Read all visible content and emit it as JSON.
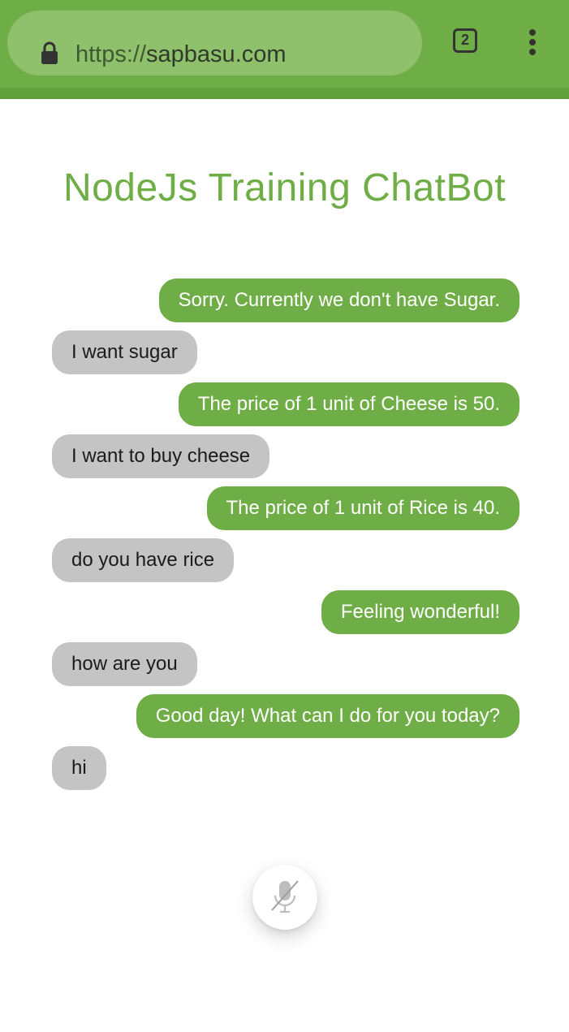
{
  "browser": {
    "url_scheme": "https://",
    "url_host": "sapbasu.com",
    "tab_count": "2",
    "lock_icon": "lock-icon",
    "menu_icon": "overflow-menu-icon",
    "toolbar_color": "#6fad46"
  },
  "page": {
    "title": "NodeJs Training ChatBot",
    "accent_color": "#6fad46"
  },
  "messages": [
    {
      "sender": "bot",
      "text": "Sorry. Currently we don't have Sugar."
    },
    {
      "sender": "user",
      "text": "I want sugar"
    },
    {
      "sender": "bot",
      "text": "The price of 1 unit of Cheese is 50."
    },
    {
      "sender": "user",
      "text": "I want to buy cheese"
    },
    {
      "sender": "bot",
      "text": "The price of 1 unit of Rice is 40."
    },
    {
      "sender": "user",
      "text": "do you have rice"
    },
    {
      "sender": "bot",
      "text": "Feeling wonderful!"
    },
    {
      "sender": "user",
      "text": "how are you"
    },
    {
      "sender": "bot",
      "text": "Good day! What can I do for you today?"
    },
    {
      "sender": "user",
      "text": "hi"
    }
  ],
  "mic": {
    "icon": "microphone-off-icon",
    "state": "muted"
  }
}
